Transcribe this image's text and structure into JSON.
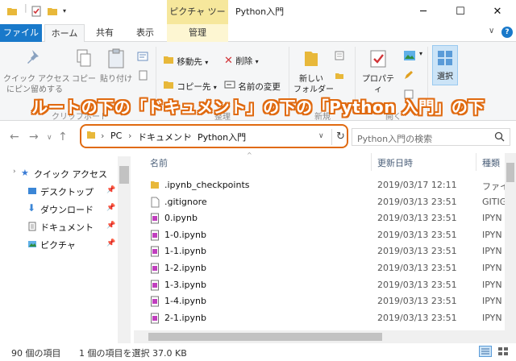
{
  "titlebar": {
    "context_tab": "ピクチャ ツール",
    "title": "Python入門",
    "minimize": "─",
    "maximize": "☐",
    "close": "✕"
  },
  "tabs": {
    "file": "ファイル",
    "home": "ホーム",
    "share": "共有",
    "view": "表示",
    "manage": "管理"
  },
  "ribbon": {
    "quick_access_pin": "クイック アクセス\nにピン留めする",
    "copy": "コピー",
    "paste": "貼り付け",
    "move_to": "移動先",
    "copy_to": "コピー先",
    "delete": "削除",
    "rename": "名前の変更",
    "new_folder": "新しい\nフォルダー",
    "properties": "プロパティ",
    "select": "選択",
    "group_clipboard": "クリップボード",
    "group_organize": "整理",
    "group_new": "新規",
    "group_open": "開く"
  },
  "annotation": "ルートの下の「ドキュメント」の下の「Python 入門」の下",
  "address": {
    "crumbs": [
      "PC",
      "ドキュメント",
      "Python入門"
    ],
    "search_placeholder": "Python入門の検索"
  },
  "nav": {
    "quick_access": "クイック アクセス",
    "items": [
      "デスクトップ",
      "ダウンロード",
      "ドキュメント",
      "ピクチャ"
    ]
  },
  "columns": {
    "name": "名前",
    "date": "更新日時",
    "type": "種類"
  },
  "files": [
    {
      "name": ".ipynb_checkpoints",
      "date": "2019/03/17 12:11",
      "type": "ファイ"
    },
    {
      "name": ".gitignore",
      "date": "2019/03/13 23:51",
      "type": "GITIG"
    },
    {
      "name": "0.ipynb",
      "date": "2019/03/13 23:51",
      "type": "IPYN"
    },
    {
      "name": "1-0.ipynb",
      "date": "2019/03/13 23:51",
      "type": "IPYN"
    },
    {
      "name": "1-1.ipynb",
      "date": "2019/03/13 23:51",
      "type": "IPYN"
    },
    {
      "name": "1-2.ipynb",
      "date": "2019/03/13 23:51",
      "type": "IPYN"
    },
    {
      "name": "1-3.ipynb",
      "date": "2019/03/13 23:51",
      "type": "IPYN"
    },
    {
      "name": "1-4.ipynb",
      "date": "2019/03/13 23:51",
      "type": "IPYN"
    },
    {
      "name": "2-1.ipynb",
      "date": "2019/03/13 23:51",
      "type": "IPYN"
    }
  ],
  "status": {
    "count": "90 個の項目",
    "selection": "1 個の項目を選択  37.0 KB"
  },
  "colors": {
    "file_tab": "#1979ca",
    "context_tab": "#f6e79c",
    "annotation_outline": "#e06a10",
    "folder": "#e8b83a"
  }
}
